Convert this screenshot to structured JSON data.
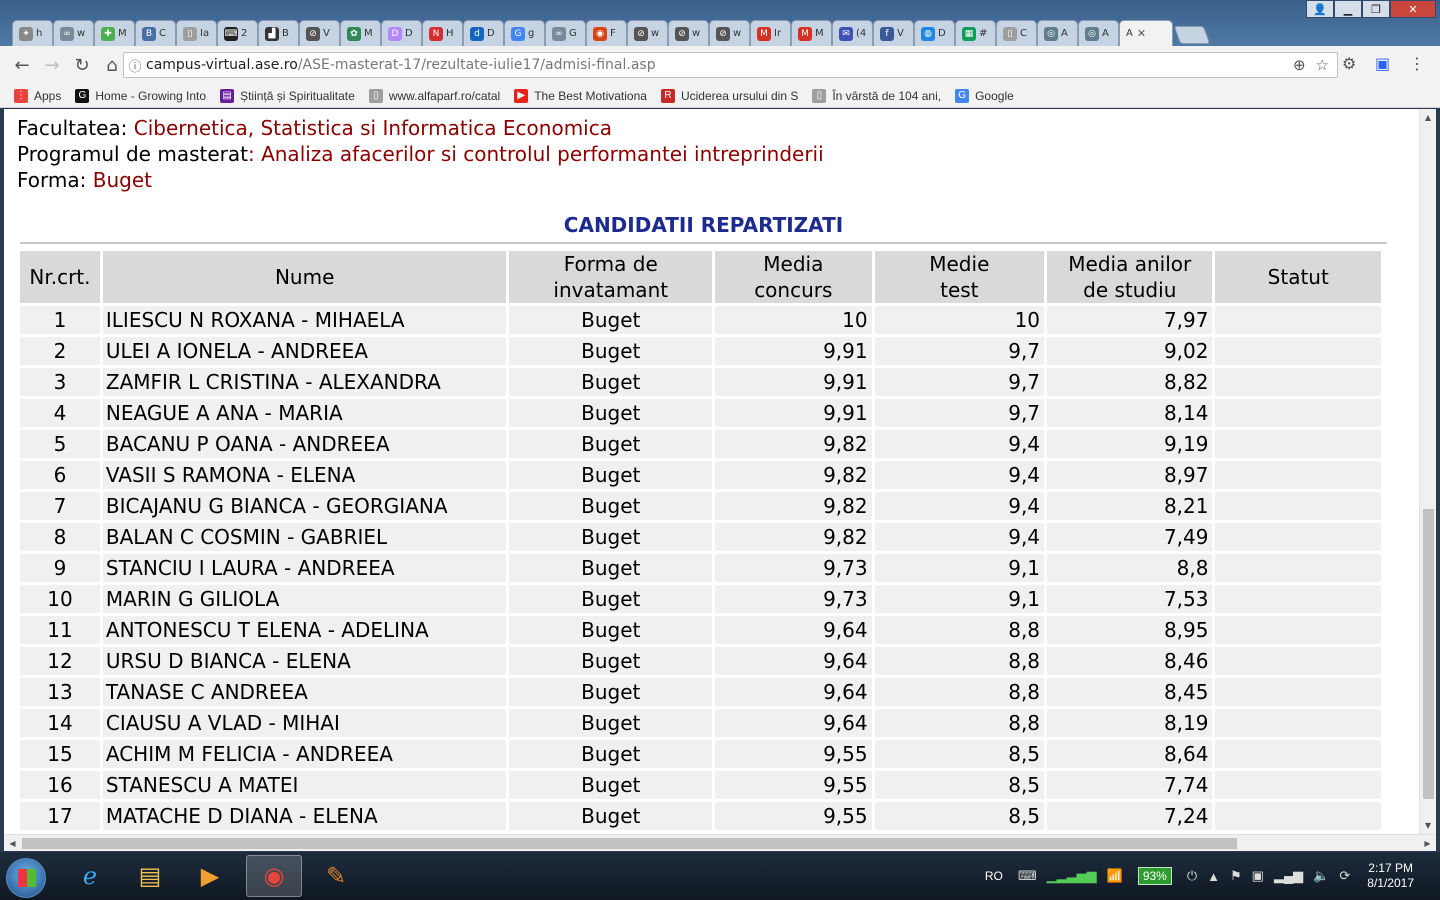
{
  "browser": {
    "tabs": [
      {
        "label": "h",
        "icon": "feather-icon",
        "color": "#888888",
        "glyph": "✦"
      },
      {
        "label": "w",
        "icon": "link-icon",
        "color": "#7a8a9a",
        "glyph": "∞"
      },
      {
        "label": "M",
        "icon": "puzzle-icon",
        "color": "#4caf50",
        "glyph": "✚"
      },
      {
        "label": "C",
        "icon": "vk-icon",
        "color": "#4a6ea8",
        "glyph": "B"
      },
      {
        "label": "Ia",
        "icon": "page-icon",
        "color": "#9e9e9e",
        "glyph": "▯"
      },
      {
        "label": "2",
        "icon": "terminal-icon",
        "color": "#222222",
        "glyph": "⌨"
      },
      {
        "label": "B",
        "icon": "boot-icon",
        "color": "#333333",
        "glyph": "▟"
      },
      {
        "label": "V",
        "icon": "circle-icon",
        "color": "#555555",
        "glyph": "⊘"
      },
      {
        "label": "M",
        "icon": "leaf-icon",
        "color": "#2e8b57",
        "glyph": "✿"
      },
      {
        "label": "D",
        "icon": "d-icon",
        "color": "#b388ff",
        "glyph": "D"
      },
      {
        "label": "H",
        "icon": "nc-icon",
        "color": "#d32f2f",
        "glyph": "N"
      },
      {
        "label": "D",
        "icon": "d-blue-icon",
        "color": "#1565c0",
        "glyph": "d"
      },
      {
        "label": "g",
        "icon": "google-icon",
        "color": "#4285f4",
        "glyph": "G"
      },
      {
        "label": "G",
        "icon": "link-icon",
        "color": "#7a8a9a",
        "glyph": "∞"
      },
      {
        "label": "F",
        "icon": "compass-icon",
        "color": "#d84315",
        "glyph": "◉"
      },
      {
        "label": "w",
        "icon": "circle-icon",
        "color": "#555555",
        "glyph": "⊘"
      },
      {
        "label": "w",
        "icon": "circle-icon",
        "color": "#555555",
        "glyph": "⊘"
      },
      {
        "label": "w",
        "icon": "circle-icon",
        "color": "#555555",
        "glyph": "⊘"
      },
      {
        "label": "Ir",
        "icon": "gmail-icon",
        "color": "#d93025",
        "glyph": "M"
      },
      {
        "label": "M",
        "icon": "gmail-icon",
        "color": "#d93025",
        "glyph": "M"
      },
      {
        "label": "(4",
        "icon": "mail-icon",
        "color": "#3f51b5",
        "glyph": "✉"
      },
      {
        "label": "V",
        "icon": "facebook-icon",
        "color": "#3b5998",
        "glyph": "f"
      },
      {
        "label": "D",
        "icon": "globe-icon",
        "color": "#1e88e5",
        "glyph": "◍"
      },
      {
        "label": "#",
        "icon": "sheets-icon",
        "color": "#0f9d58",
        "glyph": "▦"
      },
      {
        "label": "C",
        "icon": "page-icon",
        "color": "#9e9e9e",
        "glyph": "▯"
      },
      {
        "label": "A",
        "icon": "ase-icon",
        "color": "#607d8b",
        "glyph": "◎"
      },
      {
        "label": "A",
        "icon": "ase-icon",
        "color": "#607d8b",
        "glyph": "◎"
      }
    ],
    "active_tab": {
      "label": "A",
      "close": "✕"
    },
    "url_host": "campus-virtual.ase.ro",
    "url_path": "/ASE-masterat-17/rezultate-iulie17/admisi-final.asp",
    "bookmarks": [
      {
        "label": "Apps",
        "icon": "apps-grid-icon",
        "color": "#e8453c",
        "glyph": "⋮"
      },
      {
        "label": "Home - Growing Into",
        "icon": "g-black-icon",
        "color": "#111111",
        "glyph": "G"
      },
      {
        "label": "Știință și Spiritualitate",
        "icon": "purple-square-icon",
        "color": "#6a1b9a",
        "glyph": "▤"
      },
      {
        "label": "www.alfaparf.ro/catal",
        "icon": "page-icon",
        "color": "#9e9e9e",
        "glyph": "▯"
      },
      {
        "label": "The Best Motivationa",
        "icon": "youtube-icon",
        "color": "#e62117",
        "glyph": "▶"
      },
      {
        "label": "Uciderea ursului din S",
        "icon": "r-logo-icon",
        "color": "#c62828",
        "glyph": "R"
      },
      {
        "label": "În vârstă de 104 ani,",
        "icon": "page-icon",
        "color": "#9e9e9e",
        "glyph": "▯"
      },
      {
        "label": "Google",
        "icon": "google-icon",
        "color": "#4285f4",
        "glyph": "G"
      }
    ]
  },
  "page": {
    "facultate_label": "Facultatea: ",
    "facultate_value": "Cibernetica, Statistica si Informatica Economica",
    "program_label": "Programul de masterat",
    "program_sep": ": ",
    "program_value": "Analiza afacerilor si controlul performantei intreprinderii",
    "forma_label": "Forma: ",
    "forma_value": "Buget",
    "section_title": "CANDIDATII REPARTIZATI",
    "columns": {
      "nr": "Nr.crt.",
      "nume": "Nume",
      "forma_1": "Forma de",
      "forma_2": "invatamant",
      "media_1": "Media",
      "media_2": "concurs",
      "medie_1": "Medie",
      "medie_2": "test",
      "anilor_1": "Media anilor",
      "anilor_2": "de studiu",
      "statut": "Statut"
    },
    "rows": [
      {
        "nr": "1",
        "nume": "ILIESCU N ROXANA - MIHAELA",
        "forma": "Buget",
        "media": "10",
        "test": "10",
        "anilor": "7,97",
        "statut": ""
      },
      {
        "nr": "2",
        "nume": "ULEI A IONELA - ANDREEA",
        "forma": "Buget",
        "media": "9,91",
        "test": "9,7",
        "anilor": "9,02",
        "statut": ""
      },
      {
        "nr": "3",
        "nume": "ZAMFIR L CRISTINA - ALEXANDRA",
        "forma": "Buget",
        "media": "9,91",
        "test": "9,7",
        "anilor": "8,82",
        "statut": ""
      },
      {
        "nr": "4",
        "nume": "NEAGUE A ANA - MARIA",
        "forma": "Buget",
        "media": "9,91",
        "test": "9,7",
        "anilor": "8,14",
        "statut": ""
      },
      {
        "nr": "5",
        "nume": "BACANU P OANA - ANDREEA",
        "forma": "Buget",
        "media": "9,82",
        "test": "9,4",
        "anilor": "9,19",
        "statut": ""
      },
      {
        "nr": "6",
        "nume": "VASII S RAMONA - ELENA",
        "forma": "Buget",
        "media": "9,82",
        "test": "9,4",
        "anilor": "8,97",
        "statut": ""
      },
      {
        "nr": "7",
        "nume": "BICAJANU G BIANCA - GEORGIANA",
        "forma": "Buget",
        "media": "9,82",
        "test": "9,4",
        "anilor": "8,21",
        "statut": ""
      },
      {
        "nr": "8",
        "nume": "BALAN C COSMIN - GABRIEL",
        "forma": "Buget",
        "media": "9,82",
        "test": "9,4",
        "anilor": "7,49",
        "statut": ""
      },
      {
        "nr": "9",
        "nume": "STANCIU I LAURA - ANDREEA",
        "forma": "Buget",
        "media": "9,73",
        "test": "9,1",
        "anilor": "8,8",
        "statut": ""
      },
      {
        "nr": "10",
        "nume": "MARIN G GILIOLA",
        "forma": "Buget",
        "media": "9,73",
        "test": "9,1",
        "anilor": "7,53",
        "statut": ""
      },
      {
        "nr": "11",
        "nume": "ANTONESCU T ELENA - ADELINA",
        "forma": "Buget",
        "media": "9,64",
        "test": "8,8",
        "anilor": "8,95",
        "statut": ""
      },
      {
        "nr": "12",
        "nume": "URSU D BIANCA - ELENA",
        "forma": "Buget",
        "media": "9,64",
        "test": "8,8",
        "anilor": "8,46",
        "statut": ""
      },
      {
        "nr": "13",
        "nume": "TANASE C ANDREEA",
        "forma": "Buget",
        "media": "9,64",
        "test": "8,8",
        "anilor": "8,45",
        "statut": ""
      },
      {
        "nr": "14",
        "nume": "CIAUSU A VLAD - MIHAI",
        "forma": "Buget",
        "media": "9,64",
        "test": "8,8",
        "anilor": "8,19",
        "statut": ""
      },
      {
        "nr": "15",
        "nume": "ACHIM M FELICIA - ANDREEA",
        "forma": "Buget",
        "media": "9,55",
        "test": "8,5",
        "anilor": "8,64",
        "statut": ""
      },
      {
        "nr": "16",
        "nume": "STANESCU A MATEI",
        "forma": "Buget",
        "media": "9,55",
        "test": "8,5",
        "anilor": "7,74",
        "statut": ""
      },
      {
        "nr": "17",
        "nume": "MATACHE D DIANA - ELENA",
        "forma": "Buget",
        "media": "9,55",
        "test": "8,5",
        "anilor": "7,24",
        "statut": ""
      }
    ]
  },
  "taskbar": {
    "lang": "RO",
    "battery": "93%",
    "time": "2:17 PM",
    "date": "8/1/2017"
  },
  "colors": {
    "accent_red": "#8b0000",
    "title_blue": "#1d2b8f"
  }
}
